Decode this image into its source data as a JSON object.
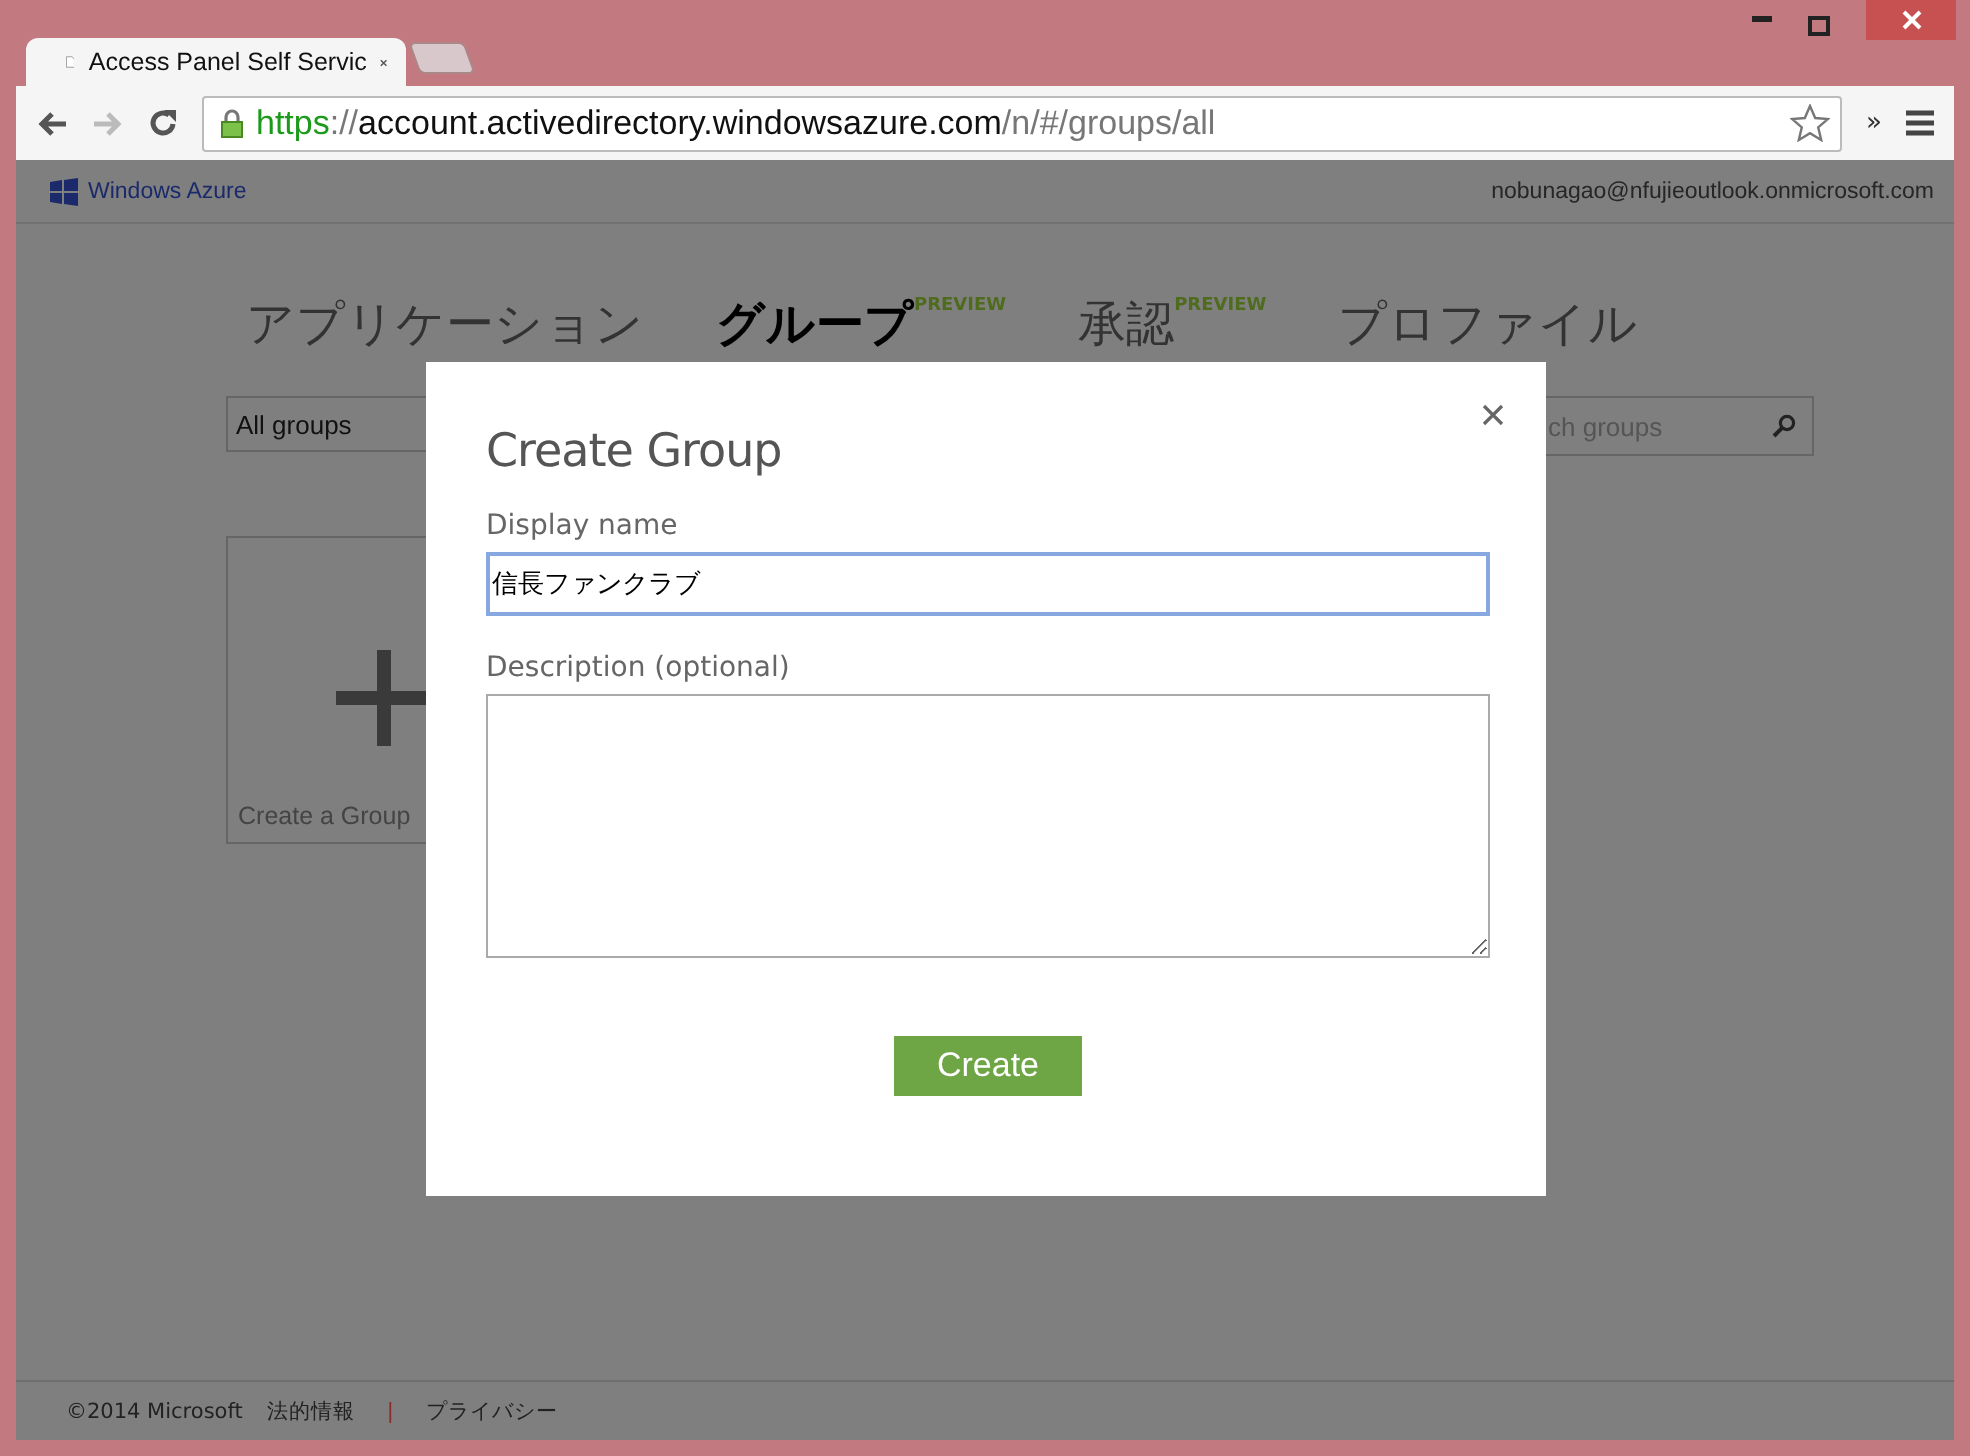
{
  "browser": {
    "tab_title": "Access Panel Self Servic",
    "url_scheme": "https",
    "url_sep": "://",
    "url_host": "account.activedirectory.windowsazure.com",
    "url_path": "/n/#/groups/all",
    "overflow": "»"
  },
  "header": {
    "brand": "Windows Azure",
    "user": "nobunagao@nfujieoutlook.onmicrosoft.com"
  },
  "nav": [
    {
      "label": "アプリケーション",
      "selected": false
    },
    {
      "label": "グループ",
      "selected": true,
      "badge": "PREVIEW"
    },
    {
      "label": "承認",
      "selected": false,
      "badge": "PREVIEW"
    },
    {
      "label": "プロファイル",
      "selected": false
    }
  ],
  "filter": {
    "value": "All groups"
  },
  "search": {
    "placeholder": "ch groups"
  },
  "tile": {
    "label": "Create a Group"
  },
  "dialog": {
    "title": "Create Group",
    "fields": [
      {
        "label": "Display name",
        "value": "信長ファンクラブ",
        "kind": "text"
      },
      {
        "label": "Description (optional)",
        "kind": "textarea"
      }
    ],
    "button": "Create"
  },
  "footer": {
    "copyright": "©2014 Microsoft",
    "links": [
      "法的情報",
      "プライバシー"
    ],
    "separator": "|"
  }
}
